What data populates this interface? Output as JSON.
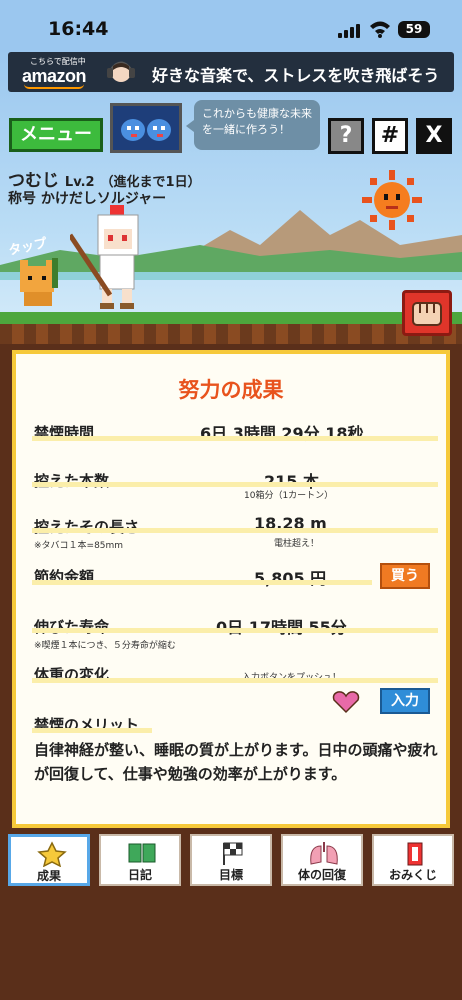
{
  "status": {
    "time": "16:44",
    "battery": "59"
  },
  "ad": {
    "small_text": "こちらで配信中",
    "logo": "amazon",
    "text": "好きな音楽で、ストレスを吹き飛ばそう"
  },
  "header": {
    "menu_label": "メニュー",
    "speech": "これからも健康な未来を一緒に作ろう！",
    "help_label": "?",
    "hash_label": "#",
    "x_label": "X"
  },
  "character": {
    "name": "つむじ",
    "level": "Lv.2",
    "evolution": "（進化まで1日）",
    "title_label": "称号",
    "title": "かけだしソルジャー",
    "tap_label": "タップ"
  },
  "card": {
    "title": "努力の成果",
    "rows": {
      "quit_time": {
        "label": "禁煙時間",
        "value": "6日  3時間  29分  18秒"
      },
      "cigs": {
        "label": "控えた本数",
        "value": "215  本",
        "sub": "10箱分（1カートン）"
      },
      "length": {
        "label": "控えたその長さ",
        "note": "※タバコ１本=85mm",
        "value": "18.28  m",
        "sub": "電柱超え！"
      },
      "money": {
        "label": "節約金額",
        "value": "5,805  円",
        "button": "買う"
      },
      "life": {
        "label": "伸びた寿命",
        "note": "※喫煙１本につき、５分寿命が縮む",
        "value": "0日  17時間  55分"
      },
      "weight": {
        "label": "体重の変化",
        "prompt": "入力ボタンをプッシュ！",
        "button": "入力"
      }
    },
    "merit_title": "禁煙のメリット",
    "merit_text": "自律神経が整い、睡眠の質が上がります。日中の頭痛や疲れが回復して、仕事や勉強の効率が上がります。"
  },
  "tabs": [
    {
      "label": "成果",
      "icon": "star-icon"
    },
    {
      "label": "日記",
      "icon": "book-icon"
    },
    {
      "label": "目標",
      "icon": "flag-icon"
    },
    {
      "label": "体の回復",
      "icon": "lungs-icon"
    },
    {
      "label": "おみくじ",
      "icon": "omikuji-icon"
    }
  ],
  "colors": {
    "accent": "#e8531d",
    "card_border": "#f6c93a",
    "active_tab": "#58a8e8"
  }
}
